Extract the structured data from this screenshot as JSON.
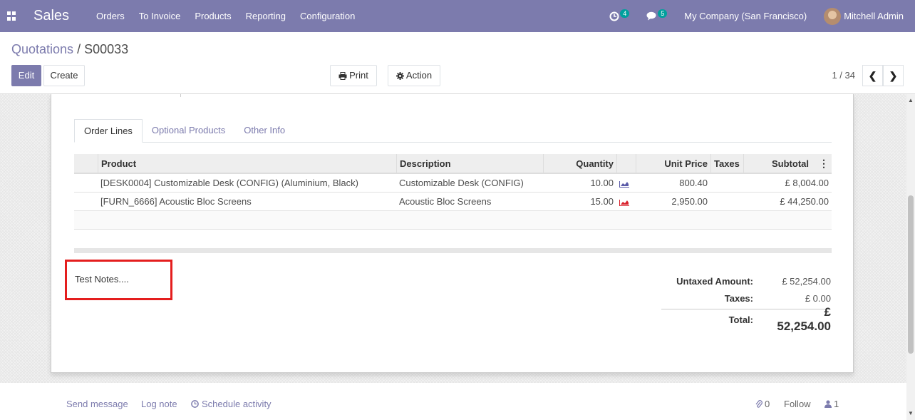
{
  "navbar": {
    "app_name": "Sales",
    "menu": [
      "Orders",
      "To Invoice",
      "Products",
      "Reporting",
      "Configuration"
    ],
    "activity_count": "4",
    "message_count": "5",
    "company": "My Company (San Francisco)",
    "user": "Mitchell Admin"
  },
  "breadcrumb": {
    "parent": "Quotations",
    "separator": "/",
    "current": "S00033"
  },
  "buttons": {
    "edit": "Edit",
    "create": "Create",
    "print": "Print",
    "action": "Action"
  },
  "pager": {
    "text": "1 / 34"
  },
  "tabs": [
    "Order Lines",
    "Optional Products",
    "Other Info"
  ],
  "order_lines": {
    "headers": [
      "Product",
      "Description",
      "Quantity",
      "Unit Price",
      "Taxes",
      "Subtotal"
    ],
    "rows": [
      {
        "product": "[DESK0004] Customizable Desk (CONFIG) (Aluminium, Black)",
        "description": "Customizable Desk (CONFIG)",
        "quantity": "10.00",
        "unit_price": "800.40",
        "taxes": "",
        "subtotal": "£ 8,004.00",
        "forecast_color": "#5b5ba8"
      },
      {
        "product": "[FURN_6666] Acoustic Bloc Screens",
        "description": "Acoustic Bloc Screens",
        "quantity": "15.00",
        "unit_price": "2,950.00",
        "taxes": "",
        "subtotal": "£ 44,250.00",
        "forecast_color": "#d9232d"
      }
    ]
  },
  "notes": "Test Notes....",
  "totals": {
    "untaxed_label": "Untaxed Amount:",
    "untaxed_value": "£ 52,254.00",
    "taxes_label": "Taxes:",
    "taxes_value": "£ 0.00",
    "total_label": "Total:",
    "total_value": "£ 52,254.00"
  },
  "chatter": {
    "send_message": "Send message",
    "log_note": "Log note",
    "schedule_activity": "Schedule activity",
    "attachments": "0",
    "follow": "Follow",
    "followers": "1"
  },
  "colors": {
    "brand": "#7c7bad",
    "badge": "#00a09d",
    "highlight": "#e41e1e"
  }
}
